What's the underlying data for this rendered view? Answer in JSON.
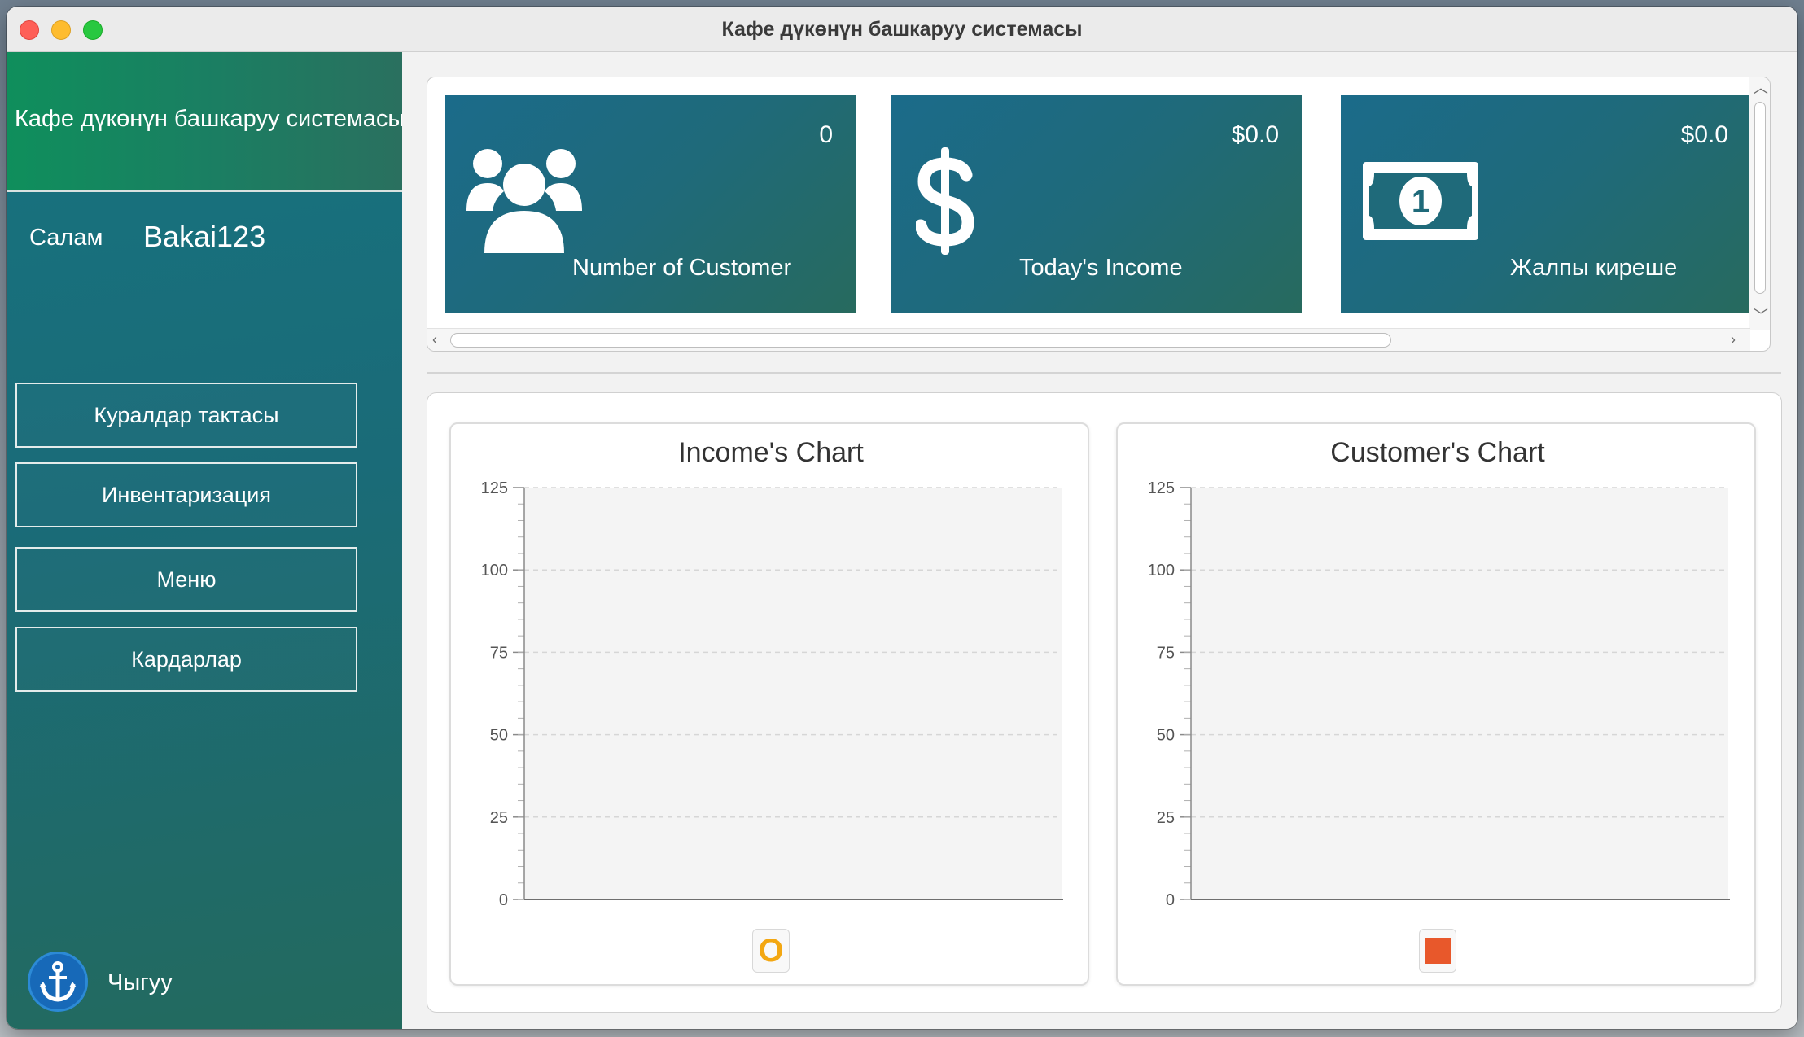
{
  "window": {
    "title": "Кафе дүкөнүн башкаруу системасы"
  },
  "sidebar": {
    "app_title": "Кафе дүкөнүн башкаруу системасы",
    "greeting": "Салам",
    "username": "Bakai123",
    "nav": [
      {
        "label": "Куралдар тактасы"
      },
      {
        "label": "Инвентаризация"
      },
      {
        "label": "Меню"
      },
      {
        "label": "Кардарлар"
      }
    ],
    "logout_label": "Чыгуу",
    "logout_icon": "anchor-icon"
  },
  "cards": [
    {
      "value": "0",
      "label": "Number of Customer",
      "icon": "users-icon"
    },
    {
      "value": "$0.0",
      "label": "Today's Income",
      "icon": "dollar-icon"
    },
    {
      "value": "$0.0",
      "label": "Жалпы киреше",
      "icon": "money-bill-icon"
    }
  ],
  "colors": {
    "sidebar_header": "#0f8f5c",
    "sidebar": "#1a6b78",
    "card": "#1f6a7a",
    "income_legend": "#f3a712",
    "customer_legend": "#e8582b"
  },
  "chart_data": [
    {
      "type": "area",
      "title": "Income's Chart",
      "xlabel": "",
      "ylabel": "",
      "ylim": [
        0,
        125
      ],
      "yticks": [
        0,
        25,
        50,
        75,
        100,
        125
      ],
      "grid": true,
      "series": [
        {
          "values": []
        }
      ],
      "legend": {
        "symbol": "O",
        "color": "#f3a712",
        "placement": "bottom"
      }
    },
    {
      "type": "bar",
      "title": "Customer's Chart",
      "xlabel": "",
      "ylabel": "",
      "ylim": [
        0,
        125
      ],
      "yticks": [
        0,
        25,
        50,
        75,
        100,
        125
      ],
      "grid": true,
      "series": [
        {
          "values": []
        }
      ],
      "legend": {
        "symbol": "square",
        "color": "#e8582b",
        "placement": "bottom"
      }
    }
  ]
}
